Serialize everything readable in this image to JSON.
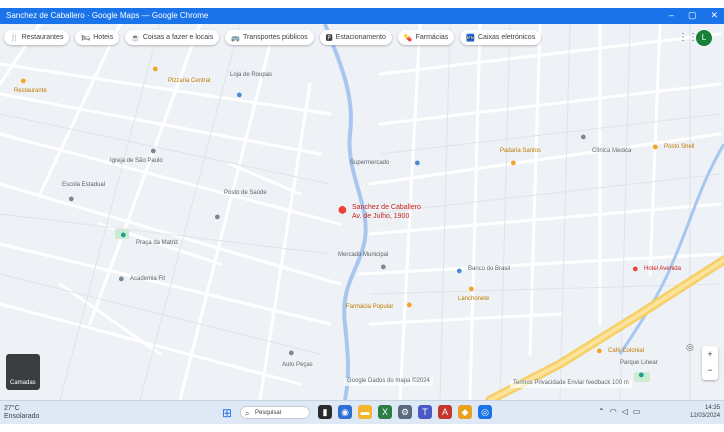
{
  "window": {
    "title": "Sanchez de Caballero · Google Maps — Google Chrome"
  },
  "chips": [
    {
      "icon": "🍴",
      "label": "Restaurantes"
    },
    {
      "icon": "🛏",
      "label": "Hoteis"
    },
    {
      "icon": "☕",
      "label": "Coisas a fazer e locais"
    },
    {
      "icon": "🚌",
      "label": "Transportes públicos"
    },
    {
      "icon": "🅿",
      "label": "Estacionamento"
    },
    {
      "icon": "💊",
      "label": "Farmácias"
    },
    {
      "icon": "🏧",
      "label": "Caixas eletrónicos"
    }
  ],
  "account": {
    "initial": "L"
  },
  "selected_place": {
    "name_line1": "Sanchez de Caballero",
    "name_line2": "Av. de Julho, 1900"
  },
  "places": [
    {
      "label": "Restaurante",
      "color": "orange"
    },
    {
      "label": "Igreja de São Paulo",
      "color": "grey"
    },
    {
      "label": "Pizzaria Central",
      "color": "orange"
    },
    {
      "label": "Escola Estadual",
      "color": "grey"
    },
    {
      "label": "Posto de Saúde",
      "color": "grey"
    },
    {
      "label": "Padaria Santos",
      "color": "orange"
    },
    {
      "label": "Supermercado",
      "color": "blue"
    },
    {
      "label": "Praça da Matriz",
      "color": "teal"
    },
    {
      "label": "Farmácia Popular",
      "color": "orange"
    },
    {
      "label": "Hotel Avenida",
      "color": "red"
    },
    {
      "label": "Lanchonete",
      "color": "orange"
    },
    {
      "label": "Banco do Brasil",
      "color": "blue"
    },
    {
      "label": "Mercado Municipal",
      "color": "grey"
    },
    {
      "label": "Auto Peças",
      "color": "grey"
    },
    {
      "label": "Café Colonial",
      "color": "orange"
    },
    {
      "label": "Academia Fit",
      "color": "grey"
    },
    {
      "label": "Loja de Roupas",
      "color": "blue"
    },
    {
      "label": "Clínica Médica",
      "color": "grey"
    },
    {
      "label": "Posto Shell",
      "color": "orange"
    },
    {
      "label": "Parque Linear",
      "color": "teal"
    }
  ],
  "streetview": {
    "label": "Camadas"
  },
  "map_footer": "Google   Dados do mapa ©2024",
  "map_footer2": "Termos   Privacidade   Enviar feedback   100 m",
  "taskbar": {
    "weather_temp": "27°C",
    "weather_text": "Ensolarado",
    "search_placeholder": "Pesquisar",
    "time": "14:35",
    "date": "12/03/2024"
  }
}
